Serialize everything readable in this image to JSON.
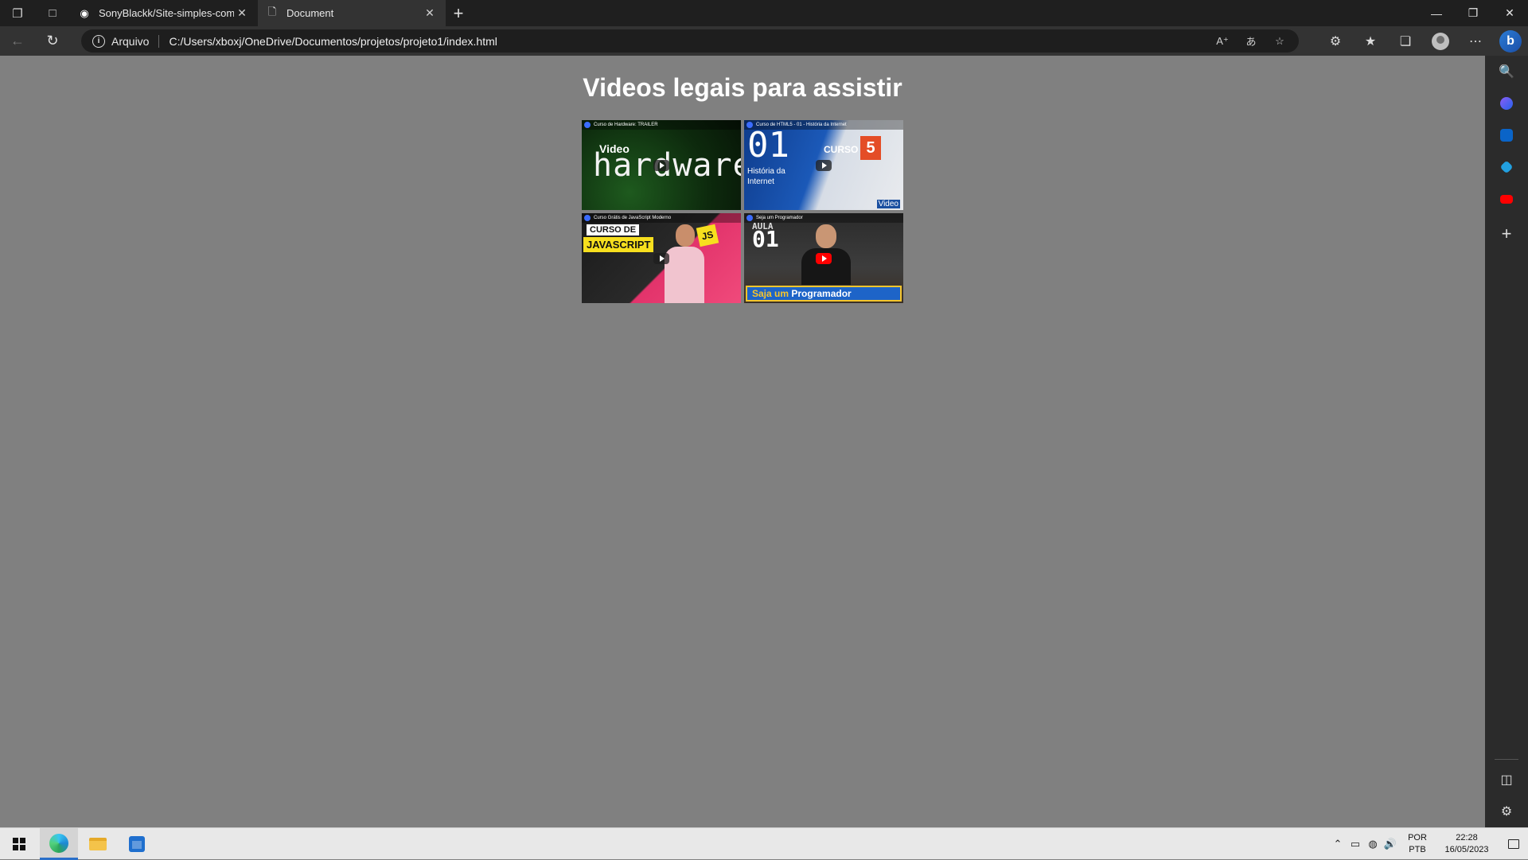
{
  "browser": {
    "tabs": [
      {
        "label": "SonyBlackk/Site-simples-com-vic",
        "favicon": "github-icon",
        "active": false
      },
      {
        "label": "Document",
        "favicon": "document-icon",
        "active": true
      }
    ],
    "address": {
      "site_label": "Arquivo",
      "url": "C:/Users/xboxj/OneDrive/Documentos/projetos/projeto1/index.html"
    }
  },
  "page": {
    "title": "Videos legais para assistir",
    "videos": [
      {
        "title": "Curso de Hardware: TRAILER",
        "thumb_text": "hardware",
        "thumb_sub": "Video"
      },
      {
        "title": "Curso de HTML5 - 01 - História da Internet",
        "thumb_num": "01",
        "thumb_text": "História da Internet",
        "thumb_badge": "5",
        "thumb_sub": "CURSO",
        "thumb_corner": "Video"
      },
      {
        "title": "Curso Grátis de JavaScript Moderno",
        "thumb_line1": "CURSO DE",
        "thumb_line2": "JAVASCRIPT",
        "thumb_badge": "JS"
      },
      {
        "title": "Seja um Programador",
        "thumb_aula": "AULA",
        "thumb_num": "01",
        "thumb_banner_a": "Saja um",
        "thumb_banner_b": "Programador"
      }
    ]
  },
  "taskbar": {
    "lang_top": "POR",
    "lang_bottom": "PTB",
    "time": "22:28",
    "date": "16/05/2023"
  },
  "colors": {
    "page_background": "#808080",
    "title_color": "#ffffff",
    "accent": "#2a6fc9"
  }
}
